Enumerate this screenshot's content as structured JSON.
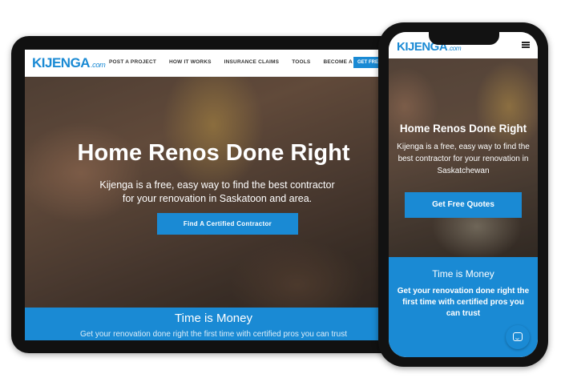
{
  "tablet": {
    "logo": {
      "main": "KIJENGA",
      "suffix": ".com"
    },
    "nav_items": [
      "POST A PROJECT",
      "HOW IT WORKS",
      "INSURANCE CLAIMS",
      "TOOLS",
      "BECOME A PRO"
    ],
    "cta_label": "GET FREE QUOTES",
    "hero": {
      "title": "Home Renos Done Right",
      "subtitle": "Kijenga is a free, easy way to find the best contractor for your renovation in Saskatoon and area.",
      "button_label": "Find A Certified Contractor"
    },
    "band": {
      "title": "Time is Money",
      "subtitle": "Get your renovation done right the first time with certified pros you can trust"
    }
  },
  "phone": {
    "logo": {
      "main": "KIJENGA",
      "suffix": ".com"
    },
    "hero": {
      "title": "Home Renos Done Right",
      "subtitle": "Kijenga is a free, easy way to find the best contractor for your renovation in Saskatchewan",
      "button_label": "Get Free Quotes"
    },
    "band": {
      "title": "Time is Money",
      "subtitle": "Get your renovation done right the first time with certified pros you can trust"
    }
  },
  "colors": {
    "brand_blue": "#1a8ad4"
  },
  "icons": {
    "menu": "hamburger-menu-icon",
    "chat": "chat-icon"
  }
}
